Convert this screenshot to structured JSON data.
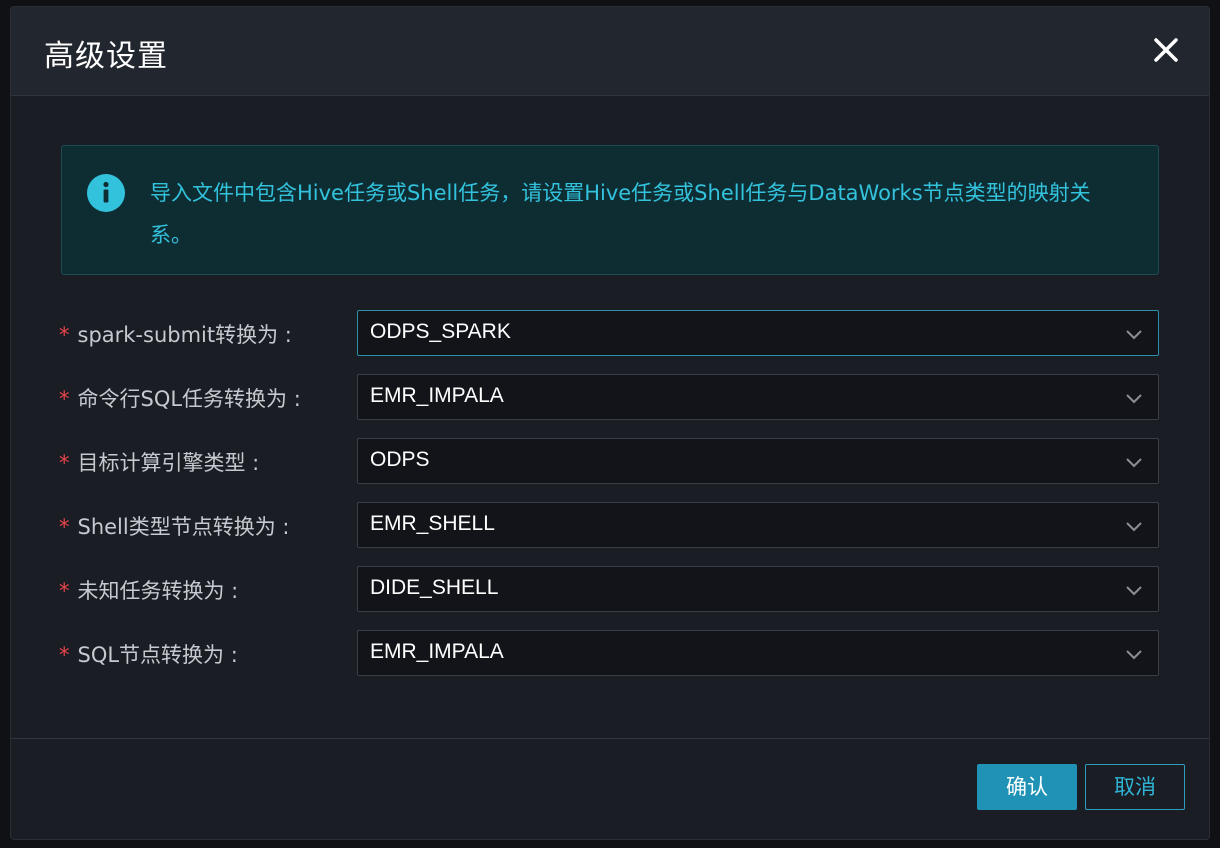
{
  "dialog": {
    "title": "高级设置",
    "close_icon": "close-icon"
  },
  "alert": {
    "icon": "info-icon",
    "text": "导入文件中包含Hive任务或Shell任务，请设置Hive任务或Shell任务与DataWorks节点类型的映射关系。"
  },
  "form": {
    "required_mark": "*",
    "fields": [
      {
        "label": "spark-submit转换为 :",
        "value": "ODPS_SPARK"
      },
      {
        "label": "命令行SQL任务转换为 :",
        "value": "EMR_IMPALA"
      },
      {
        "label": "目标计算引擎类型 :",
        "value": "ODPS"
      },
      {
        "label": "Shell类型节点转换为 :",
        "value": "EMR_SHELL"
      },
      {
        "label": "未知任务转换为 :",
        "value": "DIDE_SHELL"
      },
      {
        "label": "SQL节点转换为 :",
        "value": "EMR_IMPALA"
      }
    ]
  },
  "footer": {
    "confirm_label": "确认",
    "cancel_label": "取消"
  },
  "colors": {
    "accent": "#1f92b5",
    "alert_text": "#33c2dc",
    "required": "#e9434b"
  }
}
